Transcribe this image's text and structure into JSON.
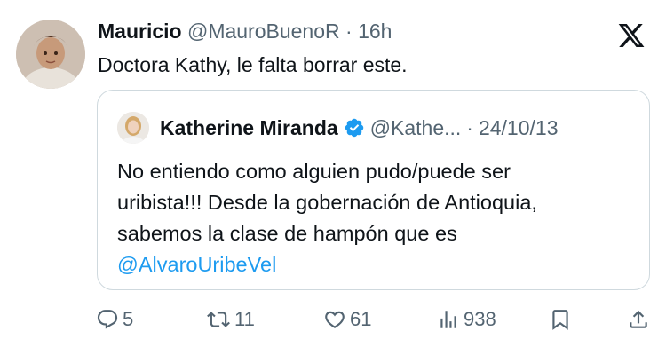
{
  "tweet": {
    "author_name": "Mauricio",
    "author_handle": "@MauroBuenoR",
    "separator": "·",
    "time": "16h",
    "text": "Doctora Kathy, le falta borrar este."
  },
  "quoted": {
    "author_name": "Katherine Miranda",
    "author_handle": "@Kathe...",
    "separator": "·",
    "date": "24/10/13",
    "text_lines": [
      "No entiendo como alguien pudo/puede ser",
      "uribista!!! Desde la gobernación de Antioquia,",
      "sabemos la clase de hampón que es"
    ],
    "mention": "@AlvaroUribeVel"
  },
  "actions": {
    "replies": "5",
    "retweets": "11",
    "likes": "61",
    "views": "938"
  },
  "icons": {
    "logo": "x-logo-icon",
    "verified": "verified-badge-icon",
    "reply": "reply-icon",
    "retweet": "retweet-icon",
    "like": "heart-icon",
    "views": "views-icon",
    "bookmark": "bookmark-icon",
    "share": "share-icon"
  },
  "colors": {
    "text": "#0f1419",
    "secondary": "#536471",
    "accent": "#1d9bf0",
    "border": "#cfd9de"
  }
}
